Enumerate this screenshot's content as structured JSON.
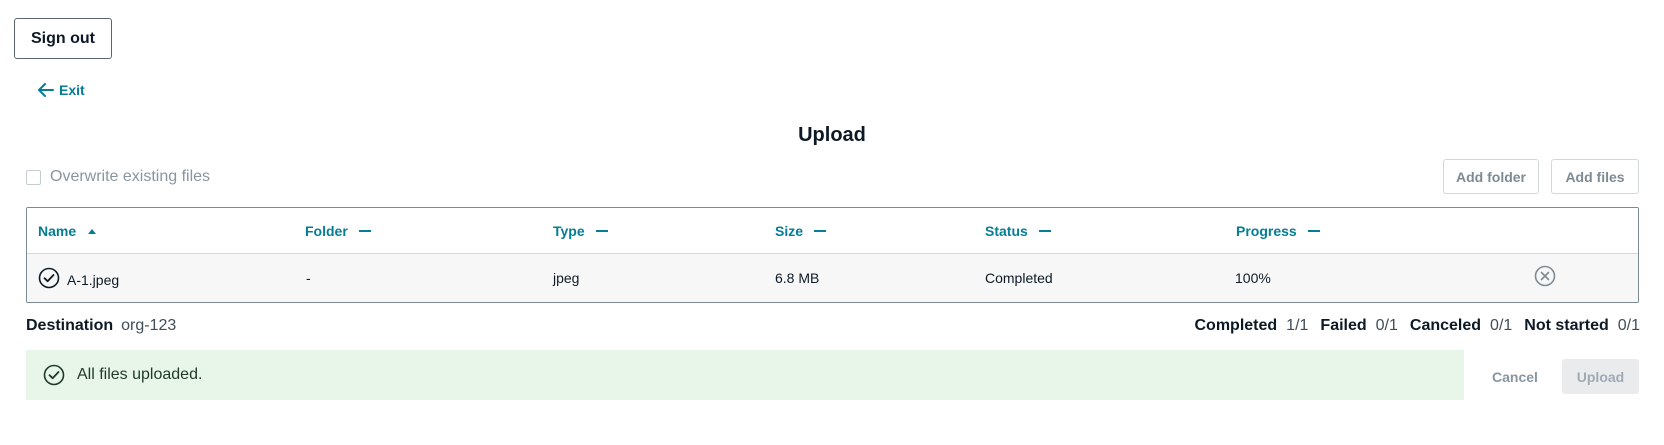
{
  "header": {
    "sign_out_label": "Sign out",
    "exit_label": "Exit"
  },
  "page": {
    "title": "Upload"
  },
  "controls": {
    "overwrite_label": "Overwrite existing files",
    "overwrite_checked": false,
    "add_folder_label": "Add folder",
    "add_files_label": "Add files"
  },
  "table": {
    "columns": [
      {
        "label": "Name",
        "sort": "ascending"
      },
      {
        "label": "Folder",
        "sort": "none"
      },
      {
        "label": "Type",
        "sort": "none"
      },
      {
        "label": "Size",
        "sort": "none"
      },
      {
        "label": "Status",
        "sort": "none"
      },
      {
        "label": "Progress",
        "sort": "none"
      }
    ],
    "rows": [
      {
        "name": "A-1.jpeg",
        "folder": "-",
        "type": "jpeg",
        "size": "6.8 MB",
        "status": "Completed",
        "progress": "100%",
        "status_icon": "check-circle-icon"
      }
    ]
  },
  "destination": {
    "label": "Destination",
    "value": "org-123"
  },
  "summary": {
    "completed_label": "Completed",
    "completed_value": "1/1",
    "failed_label": "Failed",
    "failed_value": "0/1",
    "canceled_label": "Canceled",
    "canceled_value": "0/1",
    "not_started_label": "Not started",
    "not_started_value": "0/1"
  },
  "alert": {
    "message": "All files uploaded.",
    "icon": "check-circle-icon"
  },
  "footer": {
    "cancel_label": "Cancel",
    "upload_label": "Upload"
  },
  "colors": {
    "accent": "#047d95",
    "success_bg": "#e8f5e9",
    "text": "#0d1a26",
    "muted": "#89969f"
  }
}
